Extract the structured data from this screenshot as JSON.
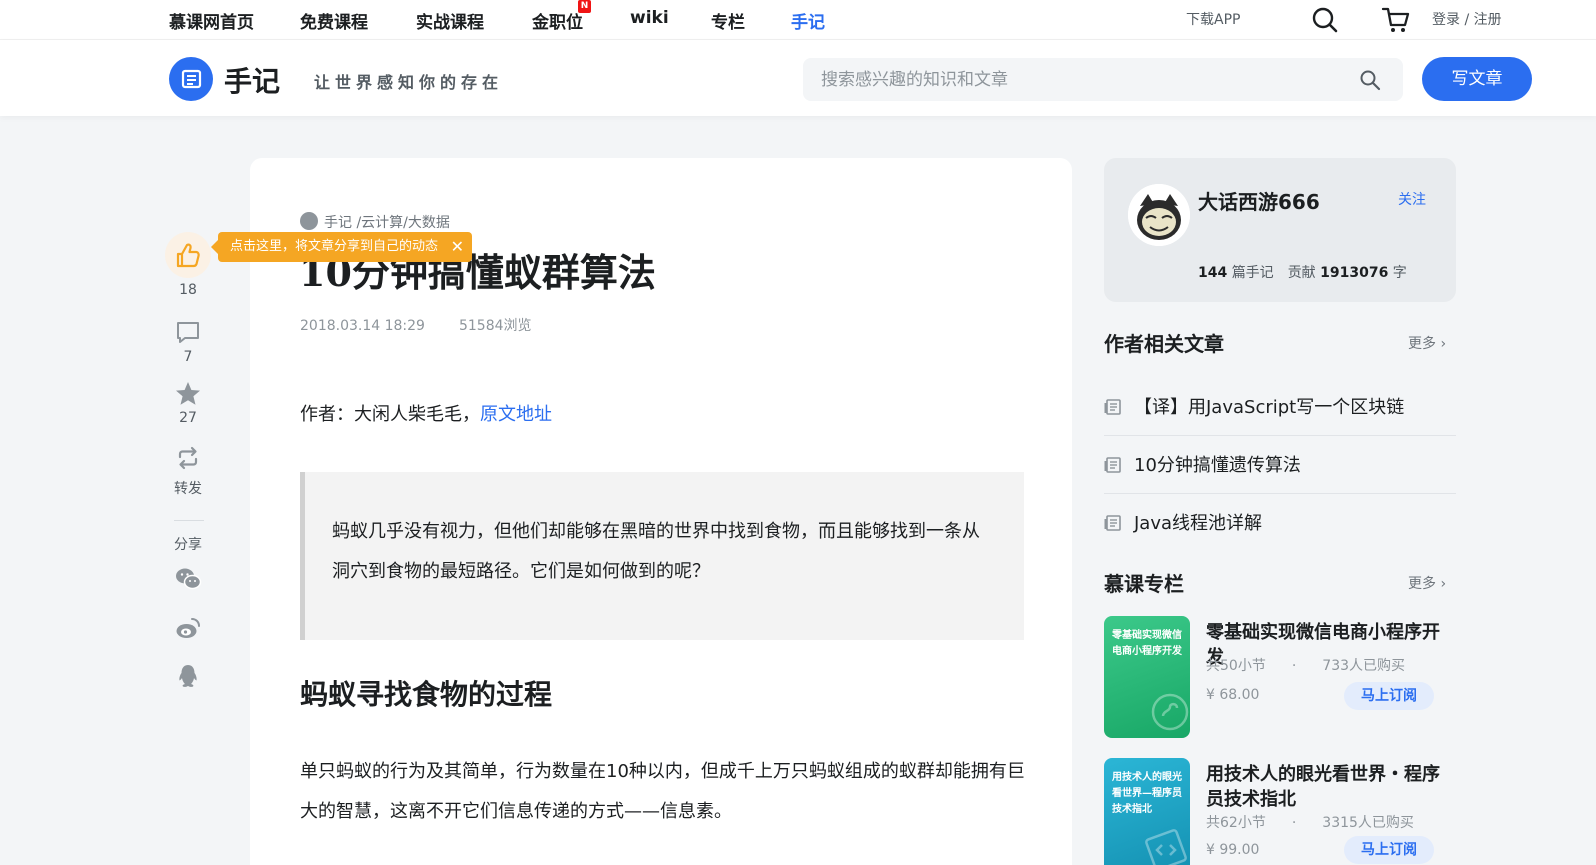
{
  "topnav": {
    "items": [
      {
        "label": "慕课网首页"
      },
      {
        "label": "免费课程"
      },
      {
        "label": "实战课程"
      },
      {
        "label": "金职位"
      },
      {
        "label": "wiki"
      },
      {
        "label": "专栏"
      },
      {
        "label": "手记"
      }
    ],
    "new_badge": "N",
    "download": "下载APP",
    "login": "登录 / 注册"
  },
  "header": {
    "logo_text": "手记",
    "slogan": "让世界感知你的存在",
    "search_placeholder": "搜索感兴趣的知识和文章",
    "write_label": "写文章",
    "accent": "#2b6ef0"
  },
  "rail": {
    "likes": "18",
    "comments": "7",
    "favorites": "27",
    "repost_label": "转发",
    "share_label": "分享"
  },
  "tooltip": {
    "text": "点击这里，将文章分享到自己的动态",
    "close": "✕"
  },
  "article": {
    "breadcrumb": "手记 /云计算/大数据",
    "title": "10分钟搞懂蚁群算法",
    "date": "2018.03.14 18:29",
    "views": "51584浏览",
    "author_prefix": "作者：大闲人柴毛毛，",
    "source_link": "原文地址",
    "quote": "蚂蚁几乎没有视力，但他们却能够在黑暗的世界中找到食物，而且能够找到一条从洞穴到食物的最短路径。它们是如何做到的呢？",
    "section_heading": "蚂蚁寻找食物的过程",
    "paragraph": "单只蚂蚁的行为及其简单，行为数量在10种以内，但成千上万只蚂蚁组成的蚁群却能拥有巨大的智慧，这离不开它们信息传递的方式——信息素。"
  },
  "author_card": {
    "name": "大话西游666",
    "follow": "关注",
    "notes_count": "144",
    "notes_label": "篇手记",
    "contrib_label": "贡献",
    "contrib_count": "1913076",
    "contrib_unit": "字"
  },
  "related": {
    "title": "作者相关文章",
    "more": "更多 ›",
    "items": [
      {
        "title": "【译】用JavaScript写一个区块链"
      },
      {
        "title": "10分钟搞懂遗传算法"
      },
      {
        "title": "Java线程池详解"
      }
    ]
  },
  "columns": {
    "title": "慕课专栏",
    "more": "更多 ›",
    "items": [
      {
        "cover_text": "零基础实现微信电商小程序开发",
        "title": "零基础实现微信电商小程序开发",
        "sections": "共50小节",
        "buyers": "733人已购买",
        "price": "¥ 68.00",
        "buy": "马上订阅",
        "color": "#2bb673"
      },
      {
        "cover_text": "用技术人的眼光看世界—程序员技术指北",
        "title": "用技术人的眼光看世界・程序员技术指北",
        "sections": "共62小节",
        "buyers": "3315人已购买",
        "price": "¥ 99.00",
        "buy": "马上订阅",
        "color": "#19a7c7"
      }
    ]
  }
}
